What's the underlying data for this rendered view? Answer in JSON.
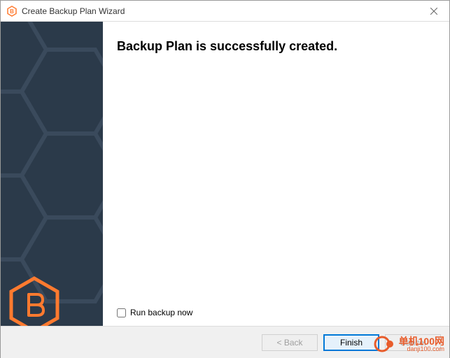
{
  "window": {
    "title": "Create Backup Plan Wizard"
  },
  "main": {
    "heading": "Backup Plan is successfully created.",
    "run_now_label": "Run backup now"
  },
  "footer": {
    "back_label": "< Back",
    "finish_label": "Finish",
    "cancel_label": "Cancel"
  },
  "watermark": {
    "line1": "单机100网",
    "line2": "danji100.com"
  }
}
